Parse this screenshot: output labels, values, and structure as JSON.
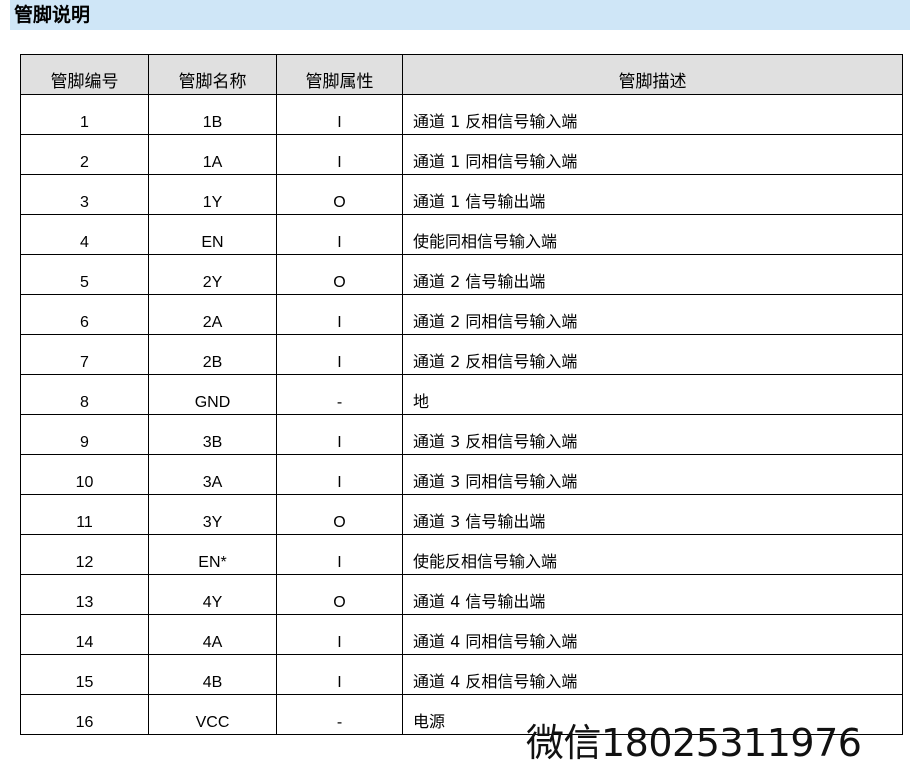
{
  "section": {
    "title": "管脚说明"
  },
  "table": {
    "headers": [
      "管脚编号",
      "管脚名称",
      "管脚属性",
      "管脚描述"
    ],
    "rows": [
      {
        "no": "1",
        "name": "1B",
        "attr": "I",
        "desc": "通道 1 反相信号输入端"
      },
      {
        "no": "2",
        "name": "1A",
        "attr": "I",
        "desc": "通道 1 同相信号输入端"
      },
      {
        "no": "3",
        "name": "1Y",
        "attr": "O",
        "desc": "通道 1 信号输出端"
      },
      {
        "no": "4",
        "name": "EN",
        "attr": "I",
        "desc": "使能同相信号输入端"
      },
      {
        "no": "5",
        "name": "2Y",
        "attr": "O",
        "desc": "通道 2 信号输出端"
      },
      {
        "no": "6",
        "name": "2A",
        "attr": "I",
        "desc": "通道 2 同相信号输入端"
      },
      {
        "no": "7",
        "name": "2B",
        "attr": "I",
        "desc": "通道 2 反相信号输入端"
      },
      {
        "no": "8",
        "name": "GND",
        "attr": "-",
        "desc": "地"
      },
      {
        "no": "9",
        "name": "3B",
        "attr": "I",
        "desc": "通道 3 反相信号输入端"
      },
      {
        "no": "10",
        "name": "3A",
        "attr": "I",
        "desc": "通道 3 同相信号输入端"
      },
      {
        "no": "11",
        "name": "3Y",
        "attr": "O",
        "desc": "通道 3 信号输出端"
      },
      {
        "no": "12",
        "name": "EN*",
        "attr": "I",
        "desc": "使能反相信号输入端"
      },
      {
        "no": "13",
        "name": "4Y",
        "attr": "O",
        "desc": "通道 4 信号输出端"
      },
      {
        "no": "14",
        "name": "4A",
        "attr": "I",
        "desc": "通道 4 同相信号输入端"
      },
      {
        "no": "15",
        "name": "4B",
        "attr": "I",
        "desc": "通道 4 反相信号输入端"
      },
      {
        "no": "16",
        "name": "VCC",
        "attr": "-",
        "desc": "电源"
      }
    ]
  },
  "watermark": {
    "text": "微信18025311976"
  },
  "colors": {
    "header_band": "#cfe6f7",
    "table_header_bg": "#e0e0e0"
  }
}
